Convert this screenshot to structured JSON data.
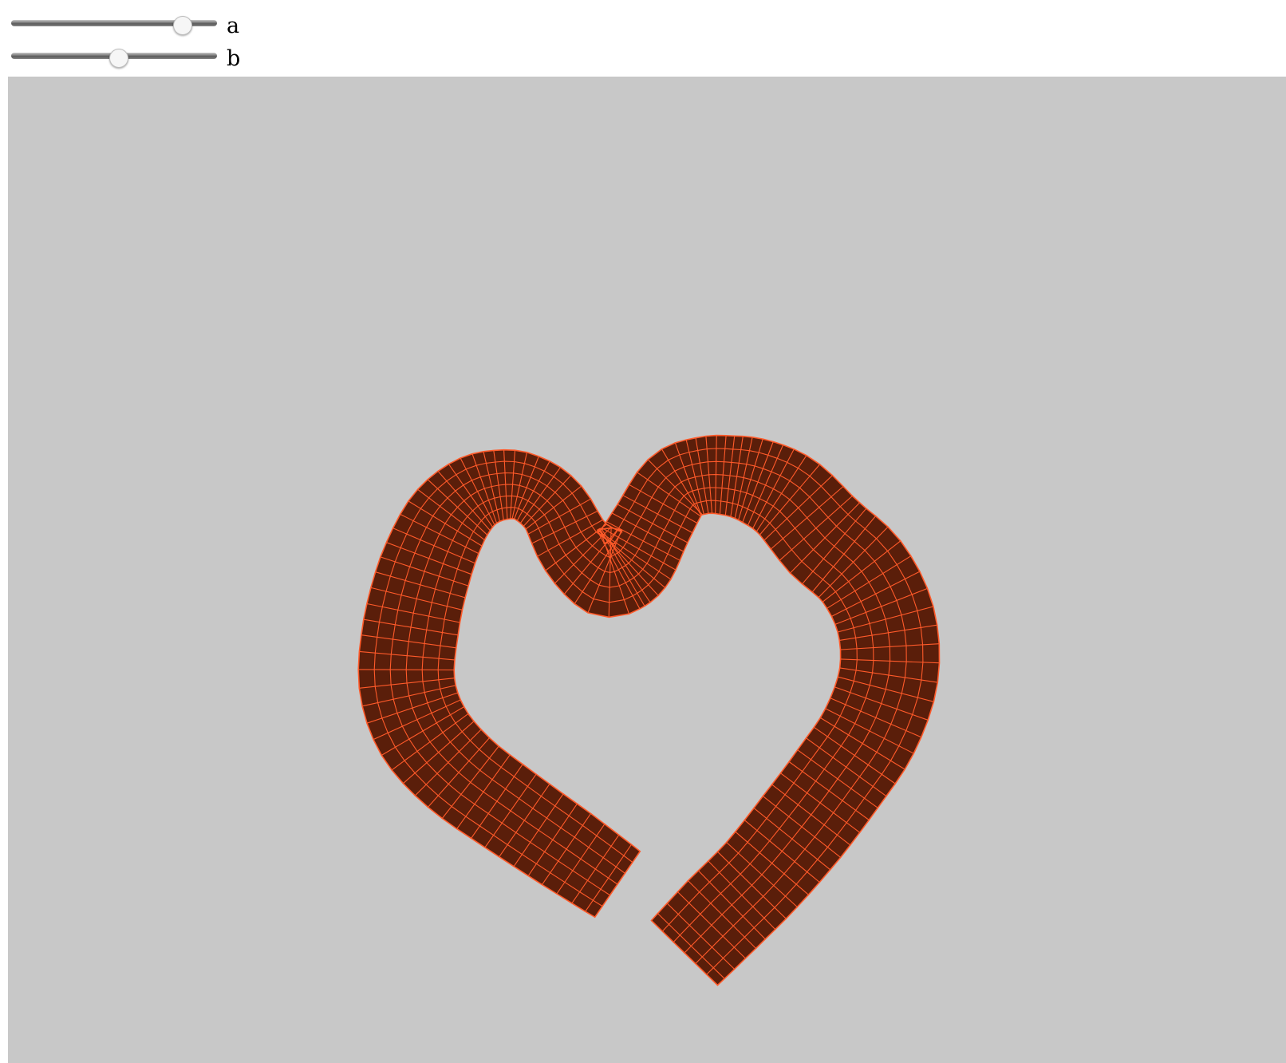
{
  "sliders": [
    {
      "label": "a",
      "value_fraction": 0.83
    },
    {
      "label": "b",
      "value_fraction": 0.52
    }
  ],
  "viewport": {
    "background": "#c8c8c8",
    "surface_fill": "#5a1e0a",
    "surface_grid": "#ff5a2a"
  }
}
